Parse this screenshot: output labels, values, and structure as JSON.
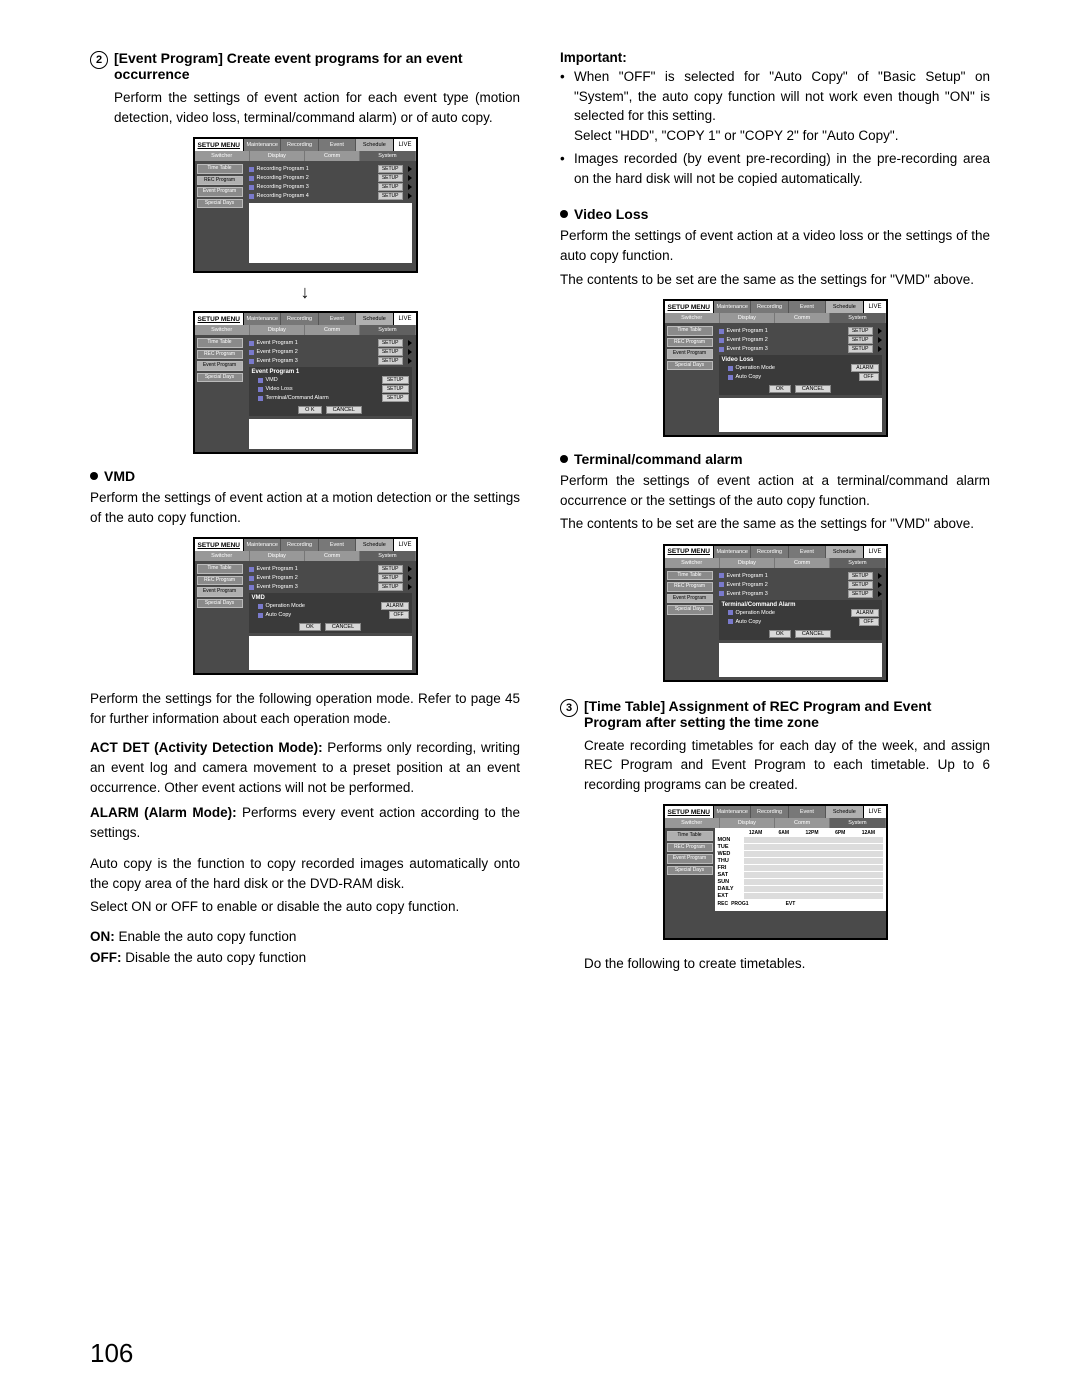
{
  "page_number": "106",
  "left": {
    "s2": {
      "num": "2",
      "title": "[Event Program] Create event programs for an event occurrence",
      "p1": "Perform the settings of event action for each event type (motion detection, video loss, terminal/command alarm) or of auto copy."
    },
    "fig1": {
      "title": "SETUP MENU",
      "tabs_top": [
        "Maintenance",
        "Recording",
        "Event",
        "Schedule"
      ],
      "live": "LIVE",
      "tabs2": [
        "Switcher",
        "Display",
        "Comm",
        "System"
      ],
      "side": [
        "Time Table",
        "REC Program",
        "Event Program",
        "Special Days"
      ],
      "rows": [
        "Recording Program 1",
        "Recording Program 2",
        "Recording Program 3",
        "Recording Program 4"
      ],
      "btn": "SETUP"
    },
    "fig2": {
      "title": "SETUP MENU",
      "rows": [
        "Event Program 1",
        "Event Program 2",
        "Event Program 3"
      ],
      "box_title": "Event Program 1",
      "box_rows": [
        "VMD",
        "Video Loss",
        "Terminal/Command Alarm"
      ],
      "btn": "SETUP",
      "ok": "O K",
      "cancel": "CANCEL"
    },
    "vmd": {
      "head": "VMD",
      "p1": "Perform the settings of event action at a motion detection or the settings of the auto copy function."
    },
    "fig3": {
      "box_title": "VMD",
      "op_mode": "Operation Mode",
      "auto_copy": "Auto Copy",
      "alarm": "ALARM",
      "off": "OFF",
      "ok": "OK",
      "cancel": "CANCEL"
    },
    "p_after_fig3": "Perform the settings for the following operation mode. Refer to page 45 for further information about each operation mode.",
    "act_det_label": "ACT DET (Activity Detection Mode):",
    "act_det_text": " Performs only recording, writing an event log and camera movement to a preset position at an event occurrence. Other event actions will not be performed.",
    "alarm_label": "ALARM (Alarm Mode):",
    "alarm_text": " Performs every event action according to the settings.",
    "autocopy_p": "Auto copy is the function to copy recorded images automatically onto the copy area of the hard disk or the DVD-RAM disk.",
    "autocopy_p2": "Select ON or OFF to enable or disable the auto copy function.",
    "on_label": "ON:",
    "on_text": " Enable the auto copy function",
    "off_label": "OFF:",
    "off_text": " Disable the auto copy function"
  },
  "right": {
    "important": "Important:",
    "imp1": "When \"OFF\" is selected for \"Auto Copy\" of \"Basic Setup\" on \"System\", the auto copy function will not work even though \"ON\" is selected for this setting.",
    "imp1b": "Select \"HDD\", \"COPY 1\" or \"COPY 2\" for \"Auto Copy\".",
    "imp2": "Images recorded (by event pre-recording) in the pre-recording area on the hard disk will not be copied automatically.",
    "vloss_head": "Video Loss",
    "vloss_p1": "Perform the settings of event action at a video loss or the settings of the auto copy function.",
    "vloss_p2": "The contents to be set are the same as the settings for \"VMD\" above.",
    "fig4": {
      "box_title": "Video Loss"
    },
    "tca_head": "Terminal/command alarm",
    "tca_p1": "Perform the settings of event action at a terminal/command alarm occurrence or the settings of the auto copy function.",
    "tca_p2": "The contents to be set are the same as the settings for \"VMD\" above.",
    "fig5": {
      "box_title": "Terminal/Command Alarm"
    },
    "s3": {
      "num": "3",
      "title": "[Time Table] Assignment of REC Program and Event Program after setting the time zone",
      "p1": "Create recording timetables for each day of the week, and assign REC Program and Event Program to each timetable. Up to 6 recording programs can be created."
    },
    "fig6": {
      "head_times": [
        "12AM",
        "6AM",
        "12PM",
        "6PM",
        "12AM"
      ],
      "days": [
        "MON",
        "TUE",
        "WED",
        "THU",
        "FRI",
        "SAT",
        "SUN",
        "DAILY",
        "EXT"
      ],
      "bottom_rec": "REC",
      "bottom_prog": "PROG1",
      "bottom_evt": "EVT"
    },
    "final_p": "Do the following to create timetables."
  }
}
